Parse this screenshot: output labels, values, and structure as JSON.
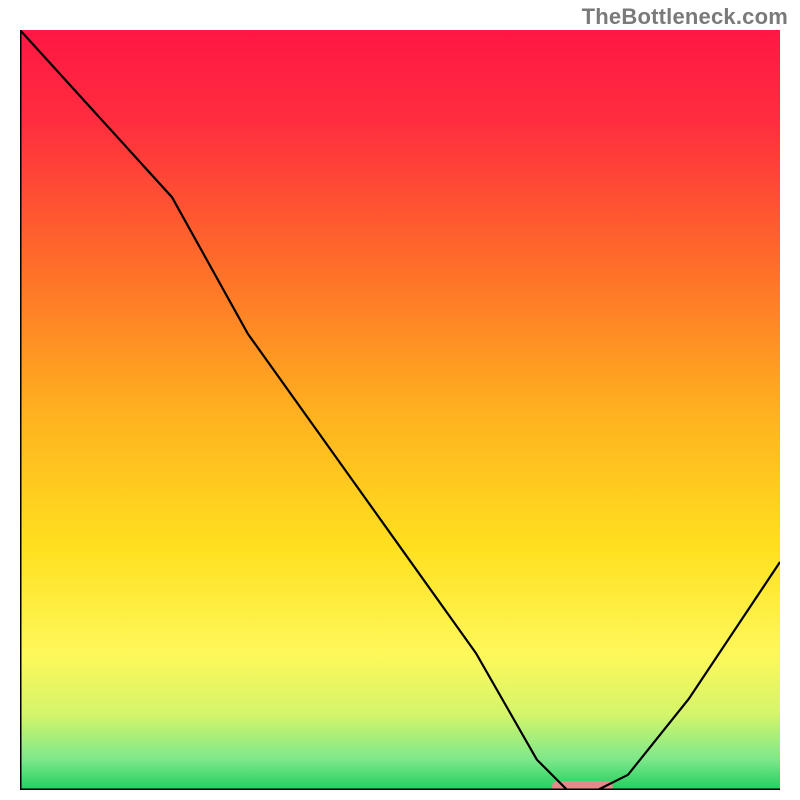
{
  "watermark": "TheBottleneck.com",
  "chart_data": {
    "type": "line",
    "title": "",
    "xlabel": "",
    "ylabel": "",
    "xlim": [
      0,
      100
    ],
    "ylim": [
      0,
      100
    ],
    "grid": false,
    "series": [
      {
        "name": "bottleneck-curve",
        "x": [
          0,
          10,
          20,
          30,
          40,
          50,
          60,
          68,
          72,
          76,
          80,
          88,
          100
        ],
        "y": [
          100,
          89,
          78,
          60,
          46,
          32,
          18,
          4,
          0,
          0,
          2,
          12,
          30
        ],
        "color": "#000000"
      }
    ],
    "marker": {
      "x_center": 74,
      "width": 8,
      "y": 0,
      "color": "#e58a8a"
    },
    "gradient_stops": [
      {
        "offset": 0.0,
        "color": "#ff1744"
      },
      {
        "offset": 0.12,
        "color": "#ff2d3f"
      },
      {
        "offset": 0.3,
        "color": "#ff6a2a"
      },
      {
        "offset": 0.5,
        "color": "#ffb01f"
      },
      {
        "offset": 0.68,
        "color": "#ffe01f"
      },
      {
        "offset": 0.82,
        "color": "#fff85a"
      },
      {
        "offset": 0.9,
        "color": "#d4f56a"
      },
      {
        "offset": 0.96,
        "color": "#7de88a"
      },
      {
        "offset": 1.0,
        "color": "#1fcf5f"
      }
    ],
    "axes_color": "#000000"
  }
}
